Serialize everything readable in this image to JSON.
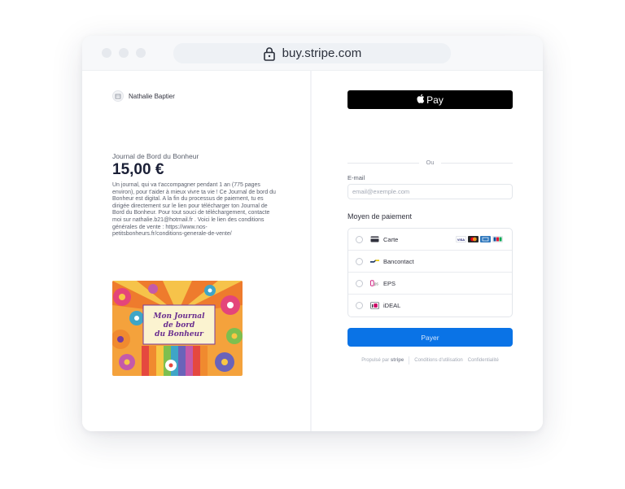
{
  "browser": {
    "url": "buy.stripe.com"
  },
  "merchant": {
    "name": "Nathalie Baptier"
  },
  "product": {
    "name": "Journal de Bord du Bonheur",
    "price": "15,00 €",
    "description": "Un journal, qui va t'accompagner pendant 1 an (775 pages environ), pour t'aider à mieux vivre ta vie ! Ce Journal de bord du Bonheur est digital. A la fin du processus de paiement, tu es dirigée directement sur le lien pour télécharger ton Journal de Bord du Bonheur. Pour tout souci de téléchargement, contacte moi sur nathalie.b21@hotmail.fr . Voici le lien des conditions générales de vente : https://www.nos-petitsbonheurs.fr/conditions-generale-de-vente/",
    "image_text": [
      "Mon Journal",
      "de bord",
      "du Bonheur"
    ]
  },
  "checkout": {
    "applepay_label": "Pay",
    "separator": "Ou",
    "email_label": "E-mail",
    "email_placeholder": "email@exemple.com",
    "payment_title": "Moyen de paiement",
    "methods": [
      {
        "label": "Carte",
        "icon": "card-icon"
      },
      {
        "label": "Bancontact",
        "icon": "bancontact-icon"
      },
      {
        "label": "EPS",
        "icon": "eps-icon"
      },
      {
        "label": "iDEAL",
        "icon": "ideal-icon"
      }
    ],
    "card_brands": [
      "VISA",
      "mastercard",
      "amex",
      "JCB"
    ],
    "pay_label": "Payer",
    "footer": {
      "powered": "Propulsé par",
      "brand": "stripe",
      "terms": "Conditions d'utilisation",
      "privacy": "Confidentialité"
    }
  },
  "colors": {
    "pay_button": "#0a73e6",
    "applepay": "#000000"
  }
}
